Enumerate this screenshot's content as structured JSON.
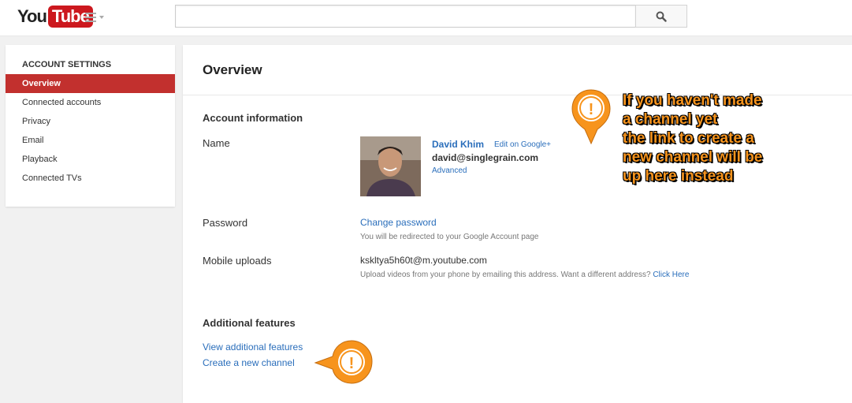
{
  "header": {
    "logo_you": "You",
    "logo_tube": "Tube",
    "search_placeholder": ""
  },
  "sidebar": {
    "title": "ACCOUNT SETTINGS",
    "items": [
      {
        "label": "Overview",
        "active": true
      },
      {
        "label": "Connected accounts"
      },
      {
        "label": "Privacy"
      },
      {
        "label": "Email"
      },
      {
        "label": "Playback"
      },
      {
        "label": "Connected TVs"
      }
    ]
  },
  "main": {
    "title": "Overview",
    "account_info": {
      "heading": "Account information",
      "name_label": "Name",
      "user_name": "David Khim",
      "edit_link": "Edit on Google+",
      "email": "david@singlegrain.com",
      "advanced_link": "Advanced",
      "password_label": "Password",
      "change_password": "Change password",
      "password_hint": "You will be redirected to your Google Account page",
      "mobile_label": "Mobile uploads",
      "mobile_address": "kskltya5h60t@m.youtube.com",
      "mobile_hint": "Upload videos from your phone by emailing this address. Want a different address?",
      "mobile_hint_link": "Click Here"
    },
    "additional": {
      "heading": "Additional features",
      "view_link": "View additional features",
      "create_link": "Create a new channel"
    }
  },
  "annotation": {
    "lines": [
      "If you haven't made",
      "a channel yet",
      "the link to create a",
      "new channel will be",
      "up here instead"
    ],
    "marker_symbol": "!"
  },
  "colors": {
    "brand_red": "#cc181e",
    "sidebar_active": "#c2302e",
    "link_blue": "#2a6ebb",
    "callout_orange": "#f7941d"
  }
}
